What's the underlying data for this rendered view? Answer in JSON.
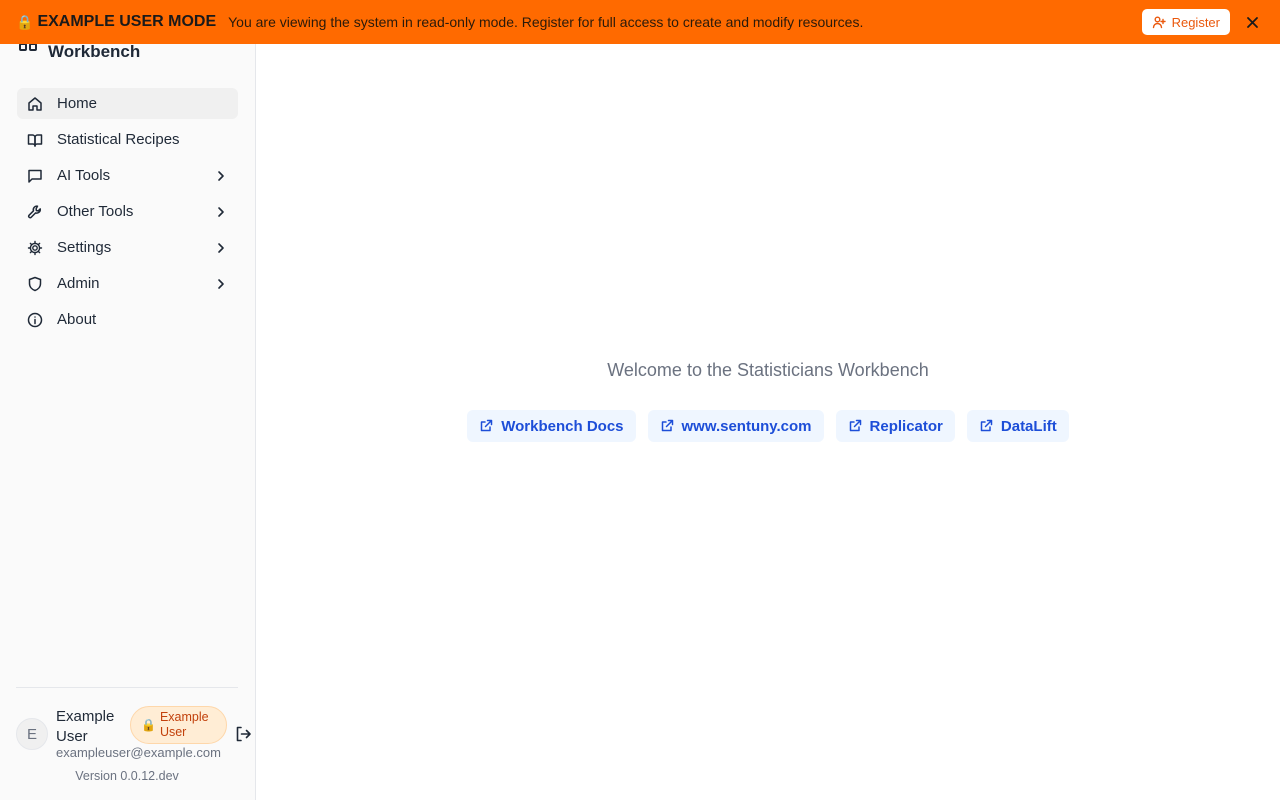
{
  "banner": {
    "title": "EXAMPLE USER MODE",
    "message": "You are viewing the system in read-only mode. Register for full access to create and modify resources.",
    "register_label": "Register",
    "color": "#ff6a00"
  },
  "sidebar": {
    "app_name": "Workbench",
    "items": [
      {
        "label": "Home",
        "icon": "home-icon",
        "active": true
      },
      {
        "label": "Statistical Recipes",
        "icon": "book-icon"
      },
      {
        "label": "AI Tools",
        "icon": "message-icon",
        "submenu": true
      },
      {
        "label": "Other Tools",
        "icon": "wrench-icon",
        "submenu": true
      },
      {
        "label": "Settings",
        "icon": "gear-icon",
        "submenu": true
      },
      {
        "label": "Admin",
        "icon": "shield-icon",
        "submenu": true
      },
      {
        "label": "About",
        "icon": "info-icon"
      }
    ],
    "user": {
      "initial": "E",
      "name": "Example User",
      "badge": "Example User",
      "email": "exampleuser@example.com"
    },
    "version": "Version 0.0.12.dev"
  },
  "main": {
    "welcome": "Welcome to the Statisticians Workbench",
    "links": [
      {
        "label": "Workbench Docs"
      },
      {
        "label": "www.sentuny.com"
      },
      {
        "label": "Replicator"
      },
      {
        "label": "DataLift"
      }
    ],
    "link_color": "#1d4ed8"
  }
}
